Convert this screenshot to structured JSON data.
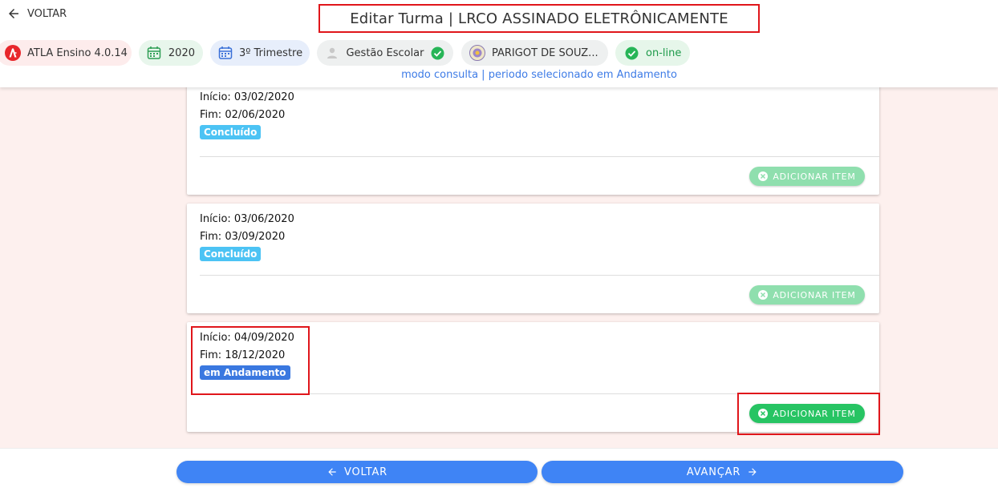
{
  "header": {
    "back_label": "VOLTAR",
    "title": "Editar Turma | LRCO ASSINADO ELETRÔNICAMENTE",
    "mode_line": "modo consulta | periodo selecionado em Andamento"
  },
  "chips": {
    "app_version": "ATLA Ensino 4.0.14",
    "year": "2020",
    "term": "3º Trimestre",
    "module": "Gestão Escolar",
    "school": "PARIGOT DE SOUZ...",
    "connection": "on-line"
  },
  "periods": [
    {
      "start": "Início: 03/02/2020",
      "end": "Fim: 02/06/2020",
      "status": "Concluído",
      "action": "ADICIONAR ITEM"
    },
    {
      "start": "Início: 03/06/2020",
      "end": "Fim: 03/09/2020",
      "status": "Concluído",
      "action": "ADICIONAR ITEM"
    },
    {
      "start": "Início: 04/09/2020",
      "end": "Fim: 18/12/2020",
      "status": "em Andamento",
      "action": "ADICIONAR ITEM"
    }
  ],
  "footer": {
    "back_label": "VOLTAR",
    "next_label": "AVANÇAR"
  },
  "colors": {
    "primary": "#3f84f5",
    "success": "#27c463",
    "concluded": "#4cc3f4",
    "in_progress": "#3a78e0",
    "highlight": "#e0161b"
  }
}
